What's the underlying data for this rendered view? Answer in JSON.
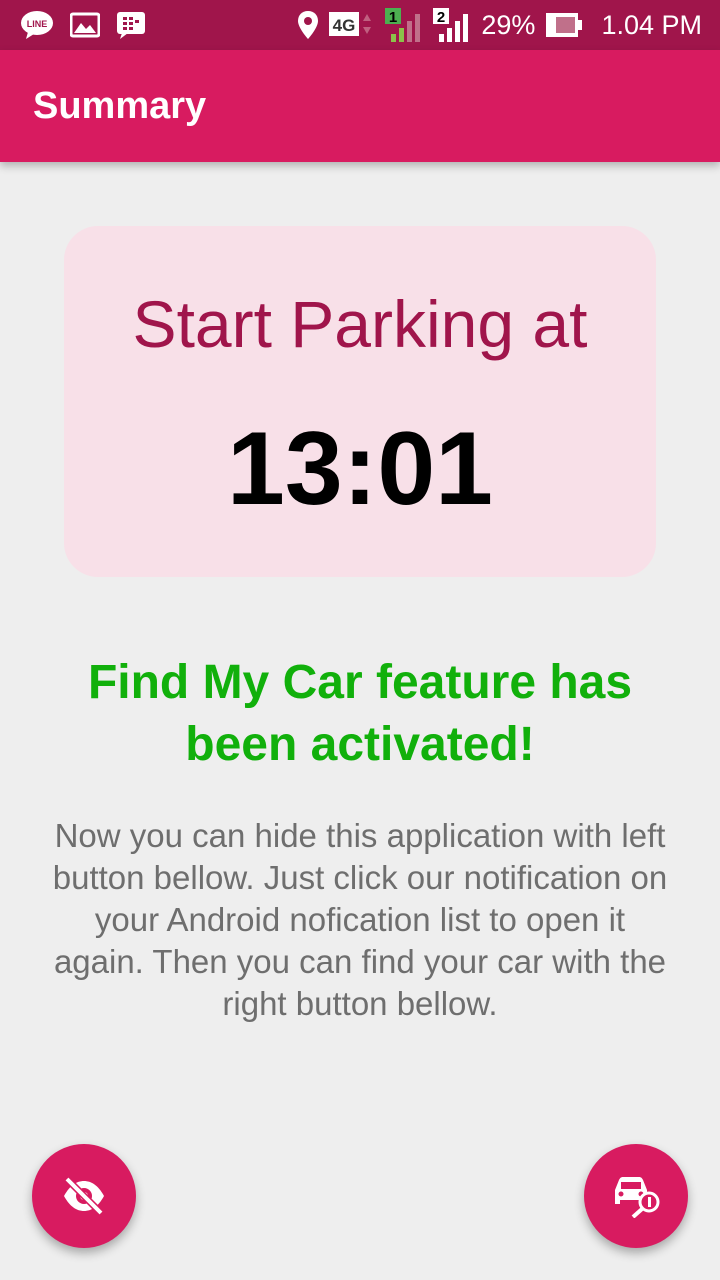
{
  "status_bar": {
    "signal_sim1": "1",
    "signal_sim2": "2",
    "network": "4G",
    "battery": "29%",
    "time": "1.04 PM"
  },
  "appbar": {
    "title": "Summary"
  },
  "card": {
    "label": "Start Parking at",
    "time": "13:01"
  },
  "message": {
    "activated": "Find My Car feature has been activated!",
    "instructions": "Now you can hide this application with left button bellow. Just click our notification on your Android nofication list to open it again. Then you can find your car with the right button bellow."
  },
  "colors": {
    "status_bar": "#a0154b",
    "primary": "#d81b60",
    "card_bg": "#f8e0e8",
    "accent_green": "#11b00b"
  },
  "icons": {
    "fab_left": "eye-off-icon",
    "fab_right": "car-search-icon"
  }
}
